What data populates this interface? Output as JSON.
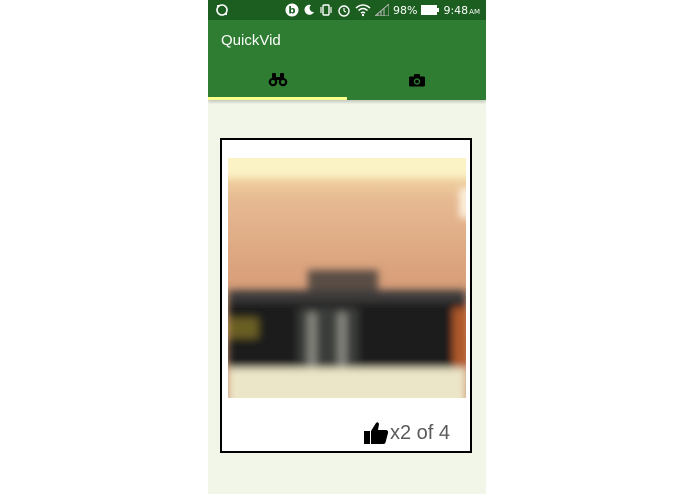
{
  "status_bar": {
    "battery_percent": "98%",
    "time": "9:48",
    "ampm": "AM",
    "icons": [
      "sync-icon",
      "beats-icon",
      "dnd-icon",
      "vibrate-icon",
      "alarm-icon",
      "wifi-icon",
      "signal-icon",
      "battery-icon"
    ]
  },
  "app": {
    "title": "QuickVid",
    "primary_color": "#2e7d32",
    "status_color": "#1b5e20",
    "indicator_color": "#ffff8d",
    "background_color": "#f1f6e9"
  },
  "tabs": [
    {
      "icon": "binoculars-icon",
      "active": true
    },
    {
      "icon": "camera-icon",
      "active": false
    }
  ],
  "card": {
    "image": "blurred-room-photo",
    "like_icon": "thumbs-up-icon",
    "likes_text": "x2 of 4"
  }
}
